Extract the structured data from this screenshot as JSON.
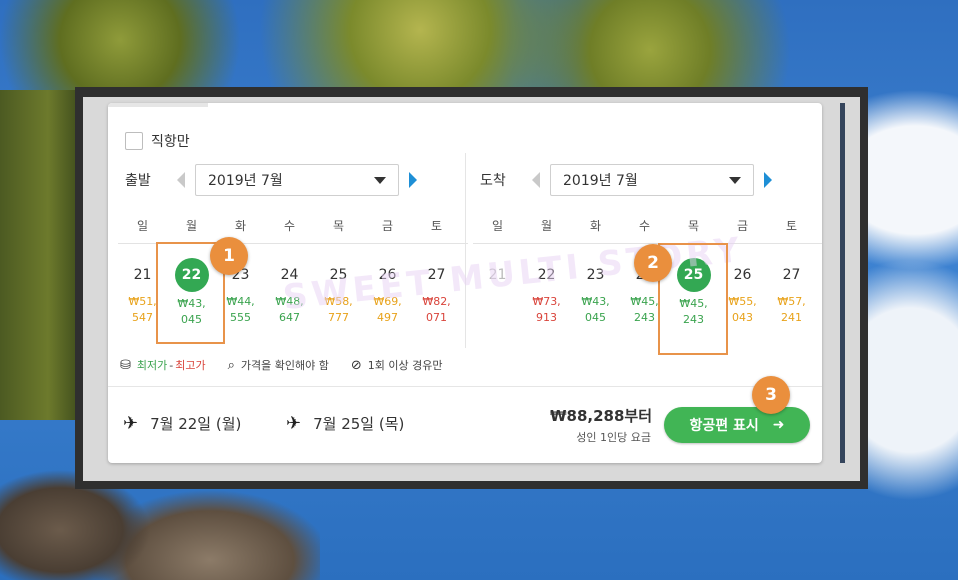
{
  "filters": {
    "direct_only_label": "직항만"
  },
  "departure": {
    "label": "출발",
    "month": "2019년 7월",
    "weekdays": [
      "일",
      "월",
      "화",
      "수",
      "목",
      "금",
      "토"
    ],
    "days": [
      {
        "num": "21",
        "price_line1": "₩51,",
        "price_line2": "547",
        "tone": "orange"
      },
      {
        "num": "22",
        "price_line1": "₩43,",
        "price_line2": "045",
        "tone": "green",
        "selected": true
      },
      {
        "num": "23",
        "price_line1": "₩44,",
        "price_line2": "555",
        "tone": "green"
      },
      {
        "num": "24",
        "price_line1": "₩48,",
        "price_line2": "647",
        "tone": "green"
      },
      {
        "num": "25",
        "price_line1": "₩58,",
        "price_line2": "777",
        "tone": "orange"
      },
      {
        "num": "26",
        "price_line1": "₩69,",
        "price_line2": "497",
        "tone": "orange"
      },
      {
        "num": "27",
        "price_line1": "₩82,",
        "price_line2": "071",
        "tone": "red"
      }
    ]
  },
  "arrival": {
    "label": "도착",
    "month": "2019년 7월",
    "weekdays": [
      "일",
      "월",
      "화",
      "수",
      "목",
      "금",
      "토"
    ],
    "days": [
      {
        "num": "21",
        "price_line1": "",
        "price_line2": "",
        "tone": "green",
        "faded": true
      },
      {
        "num": "22",
        "price_line1": "₩73,",
        "price_line2": "913",
        "tone": "red"
      },
      {
        "num": "23",
        "price_line1": "₩43,",
        "price_line2": "045",
        "tone": "green"
      },
      {
        "num": "24",
        "price_line1": "₩45,",
        "price_line2": "243",
        "tone": "green"
      },
      {
        "num": "25",
        "price_line1": "₩45,",
        "price_line2": "243",
        "tone": "green",
        "selected": true
      },
      {
        "num": "26",
        "price_line1": "₩55,",
        "price_line2": "043",
        "tone": "orange"
      },
      {
        "num": "27",
        "price_line1": "₩57,",
        "price_line2": "241",
        "tone": "orange"
      }
    ]
  },
  "legend": {
    "lowest": "최저가",
    "dash": " - ",
    "highest": "최고가",
    "check_price": "가격을 확인해야 함",
    "one_stop": "1회 이상 경유만"
  },
  "footer": {
    "outbound": "7월 22일 (월)",
    "inbound": "7월 25일 (목)",
    "price_from": "₩88,288부터",
    "per_adult": "성인 1인당 요금",
    "show_flights": "항공편 표시"
  },
  "annotations": {
    "badge1": "1",
    "badge2": "2",
    "badge3": "3",
    "watermark": "SWEET MULTI STORY"
  },
  "colors": {
    "green": "#33a853",
    "orange": "#e8a21a",
    "red": "#d9443b",
    "badge": "#ea8f3d",
    "link": "#1e8fd6"
  }
}
